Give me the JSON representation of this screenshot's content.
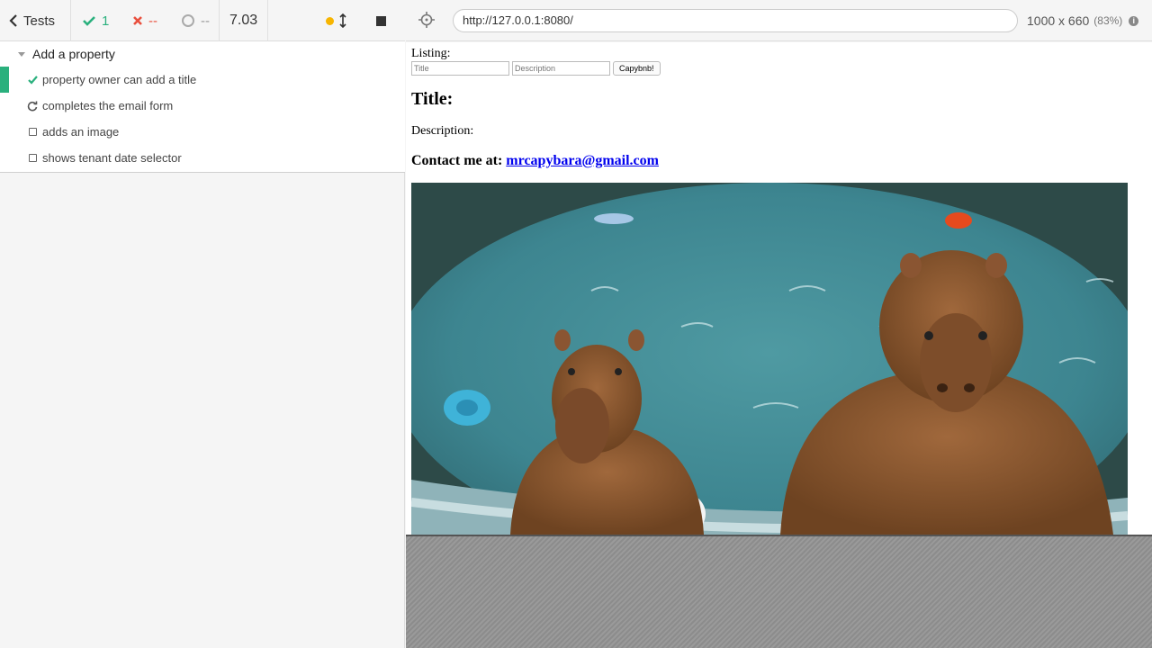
{
  "reporter": {
    "tests_label": "Tests",
    "passed": "1",
    "failed": "--",
    "pending": "--",
    "duration": "7.03",
    "suite": {
      "title": "Add a property",
      "tests": [
        {
          "title": "property owner can add a title",
          "state": "passed"
        },
        {
          "title": "completes the email form",
          "state": "running"
        },
        {
          "title": "adds an image",
          "state": "pending"
        },
        {
          "title": "shows tenant date selector",
          "state": "pending"
        }
      ]
    }
  },
  "app_header": {
    "url": "http://127.0.0.1:8080/",
    "viewport_size": "1000 x 660",
    "scale": "(83%)"
  },
  "aut": {
    "listing_label": "Listing:",
    "title_placeholder": "Title",
    "description_placeholder": "Description",
    "submit_label": "Capybnb!",
    "title_heading": "Title:",
    "description_label": "Description:",
    "contact_prefix": "Contact me at:",
    "contact_email": "mrcapybara@gmail.com"
  },
  "colors": {
    "passed": "#2ab07d",
    "failed": "#e94f3d",
    "running_dot": "#f7b500",
    "link": "#0000ee"
  }
}
